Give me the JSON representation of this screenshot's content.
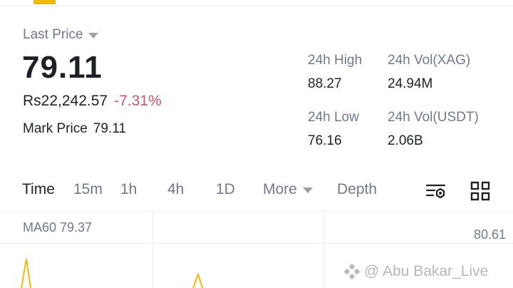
{
  "header": {
    "last_price_label": "Last Price",
    "price": "79.11",
    "fiat_price": "Rs22,242.57",
    "change_percent": "-7.31%",
    "mark_price_label": "Mark Price",
    "mark_price_value": "79.11"
  },
  "stats": {
    "high_label": "24h High",
    "high_value": "88.27",
    "vol_base_label": "24h Vol(XAG)",
    "vol_base_value": "24.94M",
    "low_label": "24h Low",
    "low_value": "76.16",
    "vol_quote_label": "24h Vol(USDT)",
    "vol_quote_value": "2.06B"
  },
  "toolbar": {
    "timeframes": [
      "Time",
      "15m",
      "1h",
      "4h",
      "1D"
    ],
    "active_timeframe": "Time",
    "more_label": "More",
    "depth_label": "Depth",
    "icons": [
      "chart-settings-icon",
      "grid-layout-icon"
    ]
  },
  "chart": {
    "ma_label": "MA60 79.37",
    "axis_max": "80.61"
  },
  "watermark": {
    "text": "@ Abu Bakar_Live"
  },
  "colors": {
    "accent": "#f0b90b",
    "negative": "#d1556a",
    "muted": "#707a8a",
    "text": "#1e2026"
  }
}
